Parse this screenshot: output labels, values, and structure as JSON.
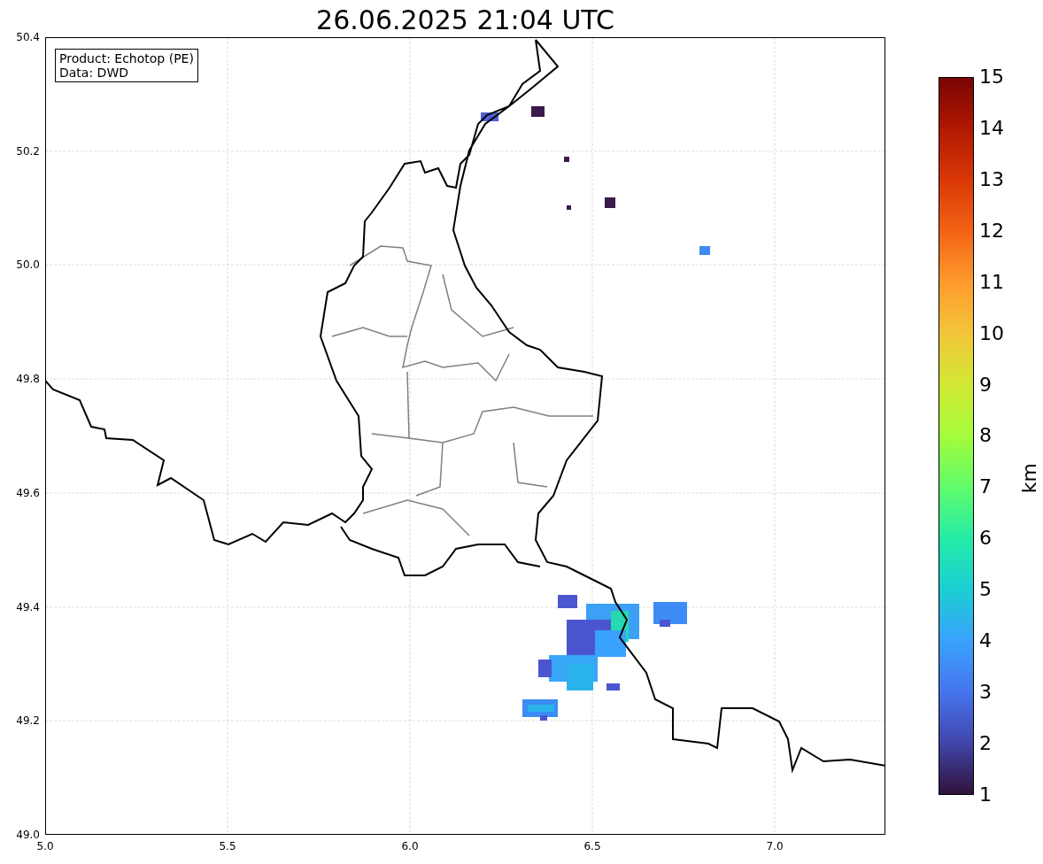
{
  "title": "26.06.2025 21:04 UTC",
  "legend": [
    "Product: Echotop (PE)",
    "Data: DWD"
  ],
  "x_ticks": [
    "5.0",
    "5.5",
    "6.0",
    "6.5",
    "7.0"
  ],
  "y_ticks": [
    "50.4",
    "50.2",
    "50.0",
    "49.8",
    "49.6",
    "49.4",
    "49.2",
    "49.0"
  ],
  "colorbar": {
    "label": "km",
    "ticks": [
      "15",
      "14",
      "13",
      "12",
      "11",
      "10",
      "9",
      "8",
      "7",
      "6",
      "5",
      "4",
      "3",
      "2",
      "1"
    ]
  }
}
